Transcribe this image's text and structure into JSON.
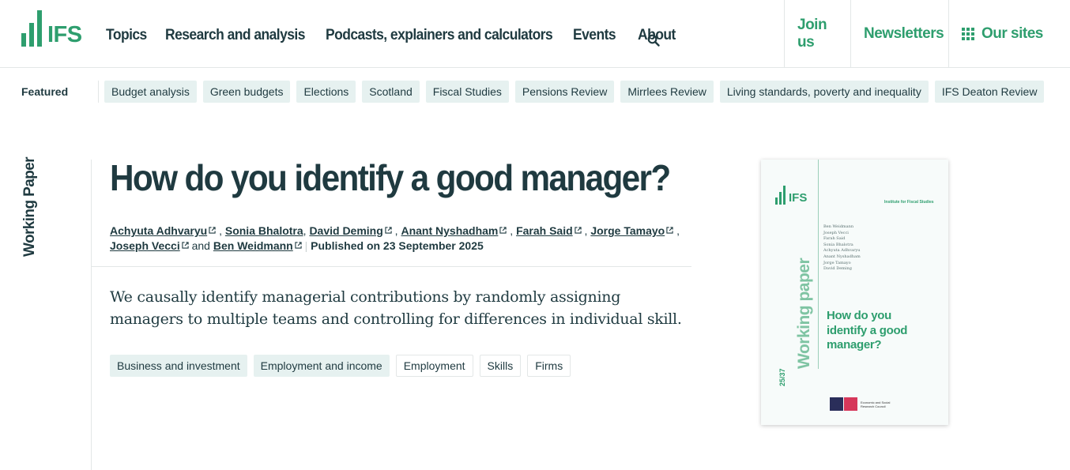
{
  "header": {
    "logo_text": "IFS",
    "nav": [
      "Topics",
      "Research and analysis",
      "Podcasts, explainers and calculators",
      "Events",
      "About"
    ],
    "right_nav": {
      "join": "Join us",
      "newsletters": "Newsletters",
      "sites": "Our sites"
    }
  },
  "featured": {
    "label": "Featured",
    "items": [
      "Budget analysis",
      "Green budgets",
      "Elections",
      "Scotland",
      "Fiscal Studies",
      "Pensions Review",
      "Mirrlees Review",
      "Living standards, poverty and inequality",
      "IFS Deaton Review"
    ]
  },
  "page": {
    "type_label": "Working Paper",
    "title": "How do you identify a good manager?",
    "authors": [
      "Achyuta Adhvaryu",
      "Sonia Bhalotra",
      "David Deming",
      "Anant Nyshadham",
      "Farah Said",
      "Jorge Tamayo",
      "Joseph Vecci",
      "Ben Weidmann"
    ],
    "and_text": "and",
    "published": "Published on 23 September 2025",
    "summary": "We causally identify managerial contributions by randomly assigning managers to multiple teams and controlling for differences in individual skill.",
    "tags": [
      {
        "label": "Business and investment",
        "style": "filled"
      },
      {
        "label": "Employment and income",
        "style": "filled"
      },
      {
        "label": "Employment",
        "style": "outline"
      },
      {
        "label": "Skills",
        "style": "outline"
      },
      {
        "label": "Firms",
        "style": "outline"
      }
    ]
  },
  "cover": {
    "logo_text": "IFS",
    "institute": "Institute for Fiscal Studies",
    "authors": [
      "Ben Weidmann",
      "Joseph Vecci",
      "Farah Said",
      "Sonia Bhalotra",
      "Achyuta Adhvaryu",
      "Anant Nyshadham",
      "Jorge Tamayo",
      "David Deming"
    ],
    "series_label": "Working paper",
    "number": "25/37",
    "title": "How do you identify a good manager?",
    "funder": "Economic and Social Research Council"
  },
  "colors": {
    "brand_green": "#2e9e6e",
    "text_dark": "#1f3a40",
    "chip_bg": "#e6f1f0"
  }
}
